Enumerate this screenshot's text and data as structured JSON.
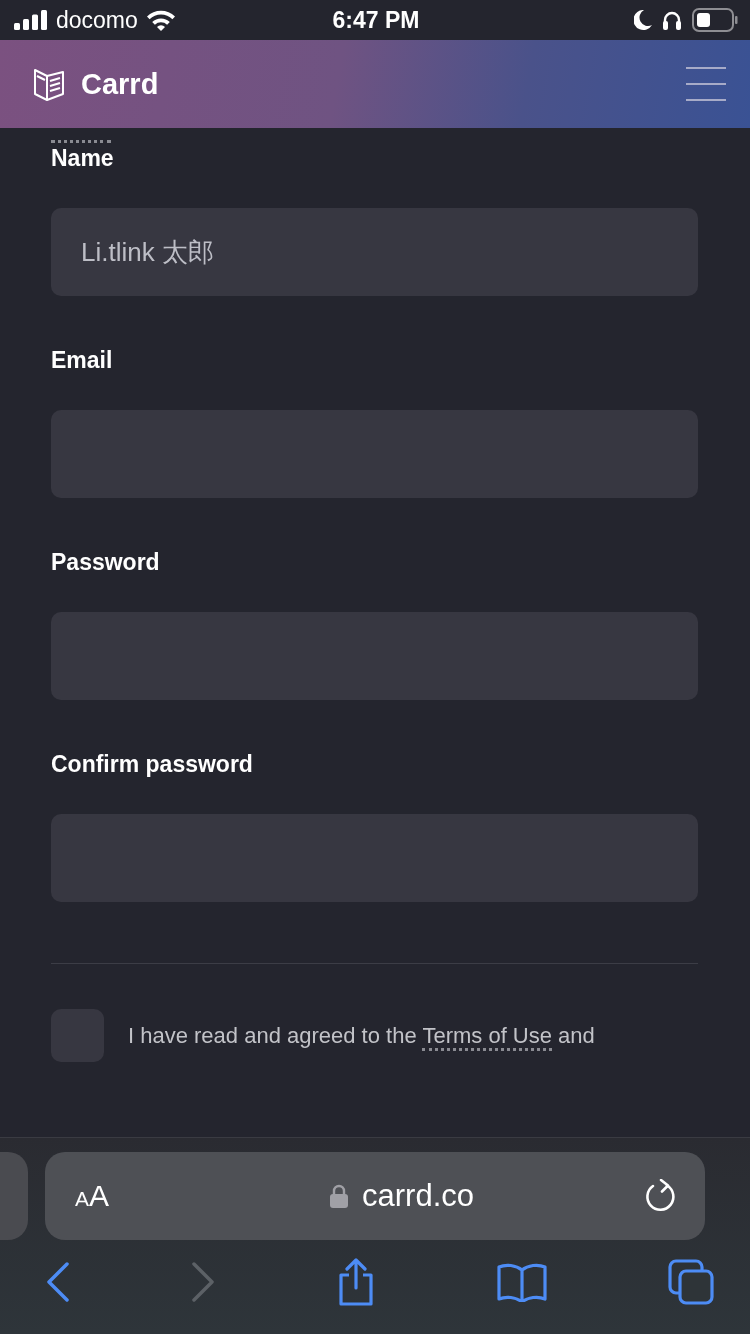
{
  "status_bar": {
    "carrier": "docomo",
    "time": "6:47 PM"
  },
  "header": {
    "title": "Carrd"
  },
  "fields": [
    {
      "label": "Name",
      "value": "Li.tlink 太郎"
    },
    {
      "label": "Email"
    },
    {
      "label": "Password"
    },
    {
      "label": "Confirm password"
    }
  ],
  "agreement": {
    "checked": false,
    "before": "I have read and agreed to the",
    "link": "Terms of Use",
    "after": "and"
  },
  "browser": {
    "text_size": [
      "A",
      "A"
    ],
    "url": "carrd.co"
  }
}
